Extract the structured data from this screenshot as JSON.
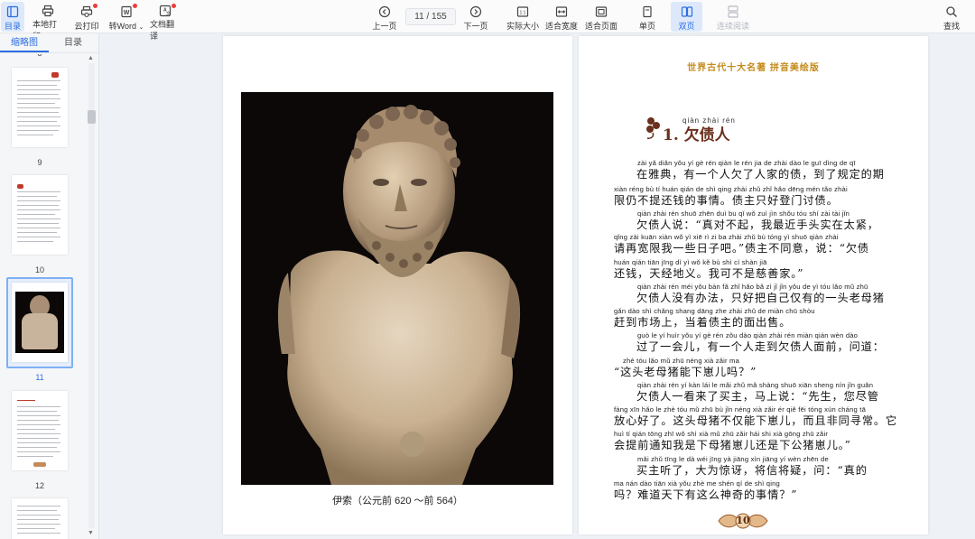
{
  "toolbar": {
    "left": [
      {
        "label": "目录",
        "icon": "toc-icon",
        "active": true
      },
      {
        "label": "本地打印",
        "icon": "printer-icon"
      },
      {
        "label": "云打印",
        "icon": "cloud-print-icon",
        "dot": true
      },
      {
        "label": "转Word",
        "icon": "word-icon",
        "dot": true,
        "dropdown": true
      },
      {
        "label": "文档翻译",
        "icon": "translate-icon",
        "dot": true
      }
    ],
    "prev_label": "上一页",
    "page_indicator": "11 / 155",
    "next_label": "下一页",
    "actual_size_label": "实际大小",
    "fit_width_label": "适合宽度",
    "fit_page_label": "适合页面",
    "single_label": "单页",
    "double_label": "双页",
    "continuous_label": "连续阅读",
    "search_label": "查找"
  },
  "sidebar": {
    "tab_thumbnails": "缩略图",
    "tab_toc": "目录",
    "top_partial_label": "8",
    "thumbnails": [
      {
        "label": "9"
      },
      {
        "label": "10"
      },
      {
        "label": "11",
        "selected": true
      },
      {
        "label": "12"
      }
    ]
  },
  "left_page": {
    "caption": "伊索（公元前 620 ～前 564）"
  },
  "right_page": {
    "header": "世界古代十大名著  拼音美绘版",
    "chapter_pinyin": "qiàn zhài rén",
    "chapter_title": "1. 欠债人",
    "lines": [
      {
        "py": "zài yǎ diǎn     yǒu yí gè rén qiàn le rén jia de zhài     dào le guī dìng de qī",
        "hz": "在雅典，有一个人欠了人家的债，到了规定的期"
      },
      {
        "py": "xiàn réng bù   tí  huán qián de shì qing     zhài zhǔ zhǐ hǎo dēng mén tǎo zhài",
        "hz": "限仍不提还钱的事情。债主只好登门讨债。"
      },
      {
        "py": "qiàn zhài rén shuō          zhēn duì  bu  qǐ     wǒ zuì jìn shǒu tóu shí zài tài jǐn",
        "hz": "欠债人说：“真对不起，我最近手头实在太紧，"
      },
      {
        "py": "qǐng zài kuān xiàn wǒ  yì  xiē  rì  zi  ba      zhài zhǔ  bù tóng yì     shuō          qiàn zhài",
        "hz": "请再宽限我一些日子吧。”债主不同意，说：“欠债"
      },
      {
        "py": "huán qián      tiān jīng dì  yì         wǒ  kě  bù shì  cí  shàn jiā",
        "hz": "还钱，天经地义。我可不是慈善家。”"
      },
      {
        "py": "qiàn zhài rén méi yǒu bàn fǎ       zhǐ  hǎo bǎ  zì  jǐ  jǐn yǒu de  yì tóu lǎo mǔ zhū",
        "hz": "欠债人没有办法，只好把自己仅有的一头老母猪"
      },
      {
        "py": "gǎn dào  shì chǎng shang    dāng zhe zhài zhǔ  de  miàn chū shòu",
        "hz": "赶到市场上，当着债主的面出售。"
      },
      {
        "py": "guò  le  yí huìr          yǒu  yí  gè  rén zǒu dào qiàn zhài rén miàn qián       wèn dào",
        "hz": "过了一会儿，有一个人走到欠债人面前，问道："
      },
      {
        "py": "zhè tóu lǎo mǔ zhū néng xià zǎir      ma",
        "hz": "“这头老母猪能下崽儿吗？”"
      },
      {
        "py": "qiàn zhài rén  yí  kàn  lái  le mǎi zhǔ        mǎ shàng shuō          xiān sheng     nín jǐn guǎn",
        "hz": "欠债人一看来了买主，马上说：“先生，您尽管"
      },
      {
        "py": "fàng xīn hǎo le      zhè tóu mǔ zhū bù jǐn néng xià zǎir       ér  qiě  fēi tóng xún cháng     tā",
        "hz": "放心好了。这头母猪不仅能下崽儿，而且非同寻常。它"
      },
      {
        "py": "huì  tí qián tōng zhī wǒ shì xià mǔ zhū zǎir   hái shi xià gōng zhū zǎir",
        "hz": "会提前通知我是下母猪崽儿还是下公猪崽儿。”"
      },
      {
        "py": "mǎi zhǔ tīng le        dà wéi jīng yà       jiāng xìn jiāng yí          wèn           zhēn de",
        "hz": "买主听了，大为惊讶，将信将疑，问：“真的"
      },
      {
        "py": "ma     nán dào tiān xià yǒu zhè me shén qí de shì qing",
        "hz": "吗？难道天下有这么神奇的事情？”"
      }
    ],
    "page_number": "10"
  },
  "colors": {
    "accent": "#2b6de0",
    "header_gold": "#c48a1a",
    "title_brown": "#6a2f1d",
    "photo_bg": "#0b0807"
  }
}
